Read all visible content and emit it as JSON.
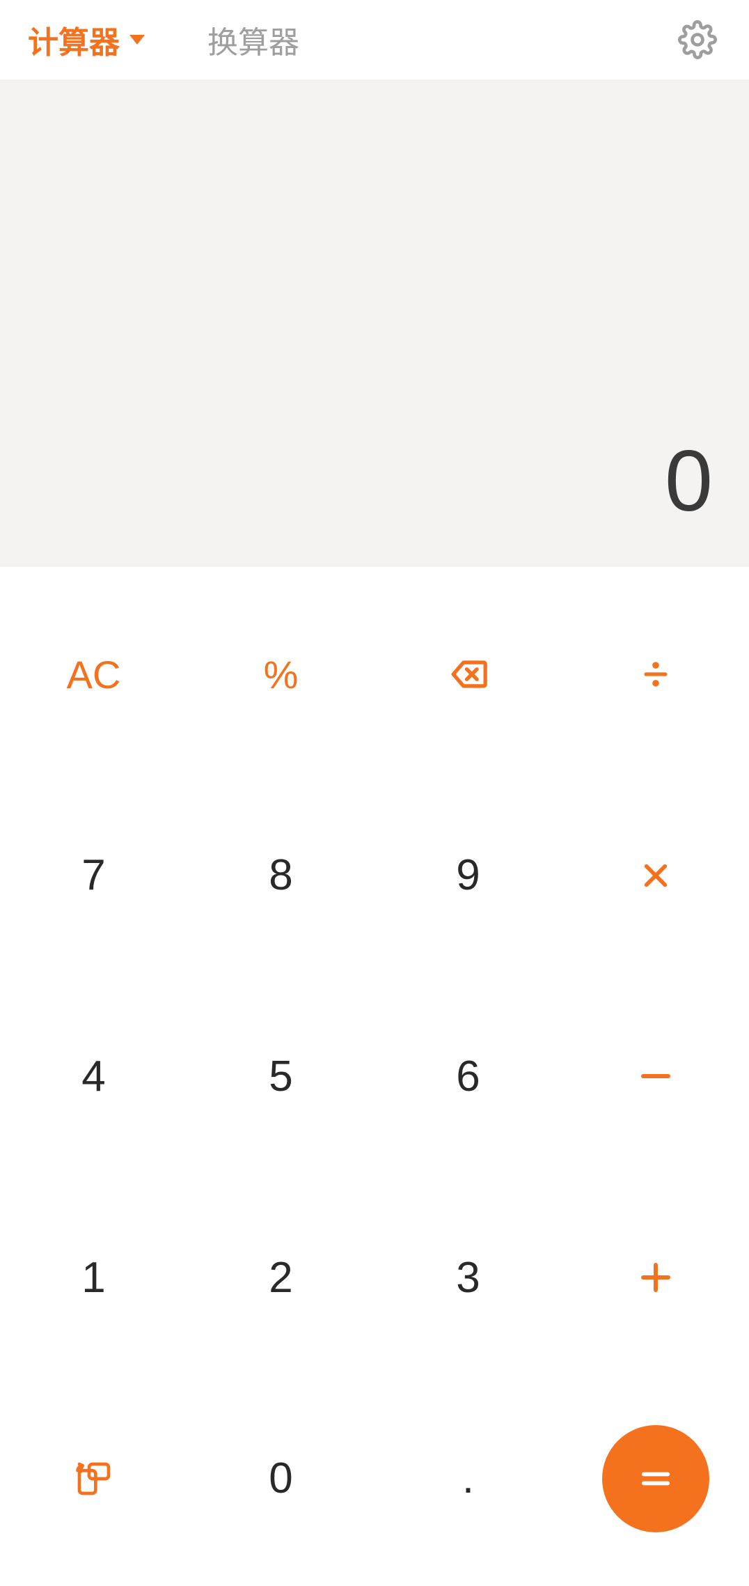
{
  "header": {
    "tab_calculator": "计算器",
    "tab_converter": "换算器"
  },
  "display": {
    "value": "0"
  },
  "keys": {
    "ac": "AC",
    "percent": "%",
    "backspace": "backspace-icon",
    "divide": "÷",
    "seven": "7",
    "eight": "8",
    "nine": "9",
    "multiply": "×",
    "four": "4",
    "five": "5",
    "six": "6",
    "minus": "−",
    "one": "1",
    "two": "2",
    "three": "3",
    "plus": "+",
    "rotate": "rotate-icon",
    "zero": "0",
    "dot": ".",
    "equals": "="
  },
  "colors": {
    "accent": "#f4711e",
    "muted": "#9e9e9e",
    "digit": "#292929",
    "display_bg": "#f4f3f1"
  }
}
